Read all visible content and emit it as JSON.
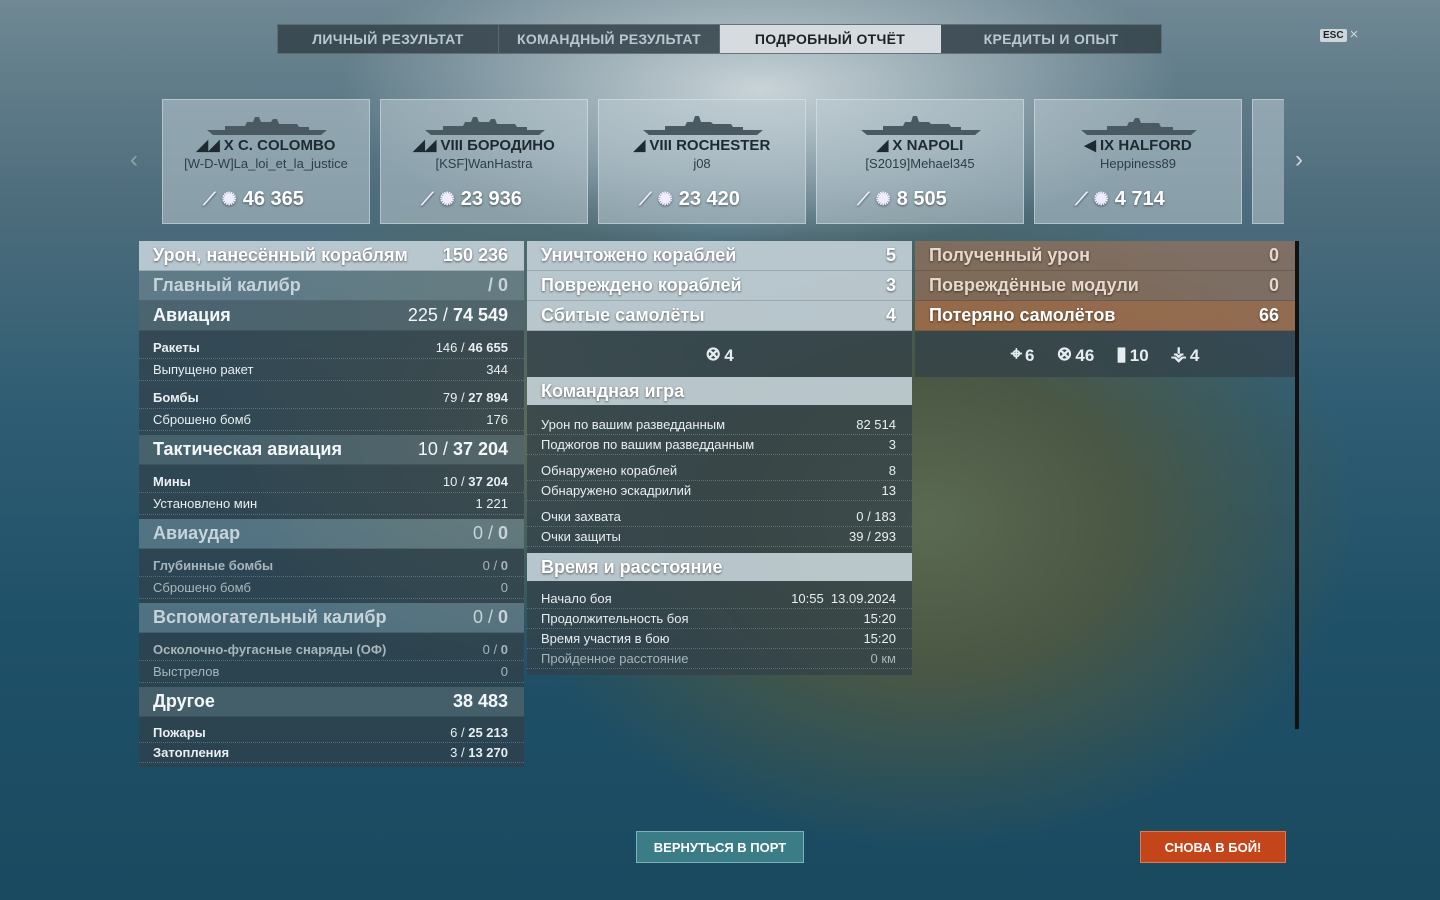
{
  "tabs": [
    {
      "label": "ЛИЧНЫЙ РЕЗУЛЬТАТ",
      "active": false
    },
    {
      "label": "КОМАНДНЫЙ РЕЗУЛЬТАТ",
      "active": false
    },
    {
      "label": "ПОДРОБНЫЙ ОТЧЁТ",
      "active": true
    },
    {
      "label": "КРЕДИТЫ И ОПЫТ",
      "active": false
    }
  ],
  "esc": {
    "key": "ESC",
    "close": "×"
  },
  "nav": {
    "prev": "‹",
    "next": "›"
  },
  "cards": [
    {
      "title": "X C. COLOMBO",
      "player": "[W-D-W]La_loi_et_la_justice",
      "damage": "46 365",
      "class_icon": "battleship-icon"
    },
    {
      "title": "VIII БОРОДИНО",
      "player": "[KSF]WanHastra",
      "damage": "23 936",
      "class_icon": "battleship-icon"
    },
    {
      "title": "VIII ROCHESTER",
      "player": "j08",
      "damage": "23 420",
      "class_icon": "cruiser-icon"
    },
    {
      "title": "X NAPOLI",
      "player": "[S2019]Mehael345",
      "damage": "8 505",
      "class_icon": "cruiser-icon"
    },
    {
      "title": "IX HALFORD",
      "player": "Heppiness89",
      "damage": "4 714",
      "class_icon": "destroyer-icon"
    }
  ],
  "left": {
    "damage": {
      "label": "Урон, нанесённый кораблям",
      "value": "150 236"
    },
    "main": {
      "label": "Главный калибр",
      "a": "/",
      "b": "0"
    },
    "aviation": {
      "label": "Авиация",
      "a": "225 /",
      "b": "74 549"
    },
    "rockets": {
      "label": "Ракеты",
      "a": "146 /",
      "b": "46 655"
    },
    "rockets_fired": {
      "label": "Выпущено ракет",
      "value": "344"
    },
    "bombs": {
      "label": "Бомбы",
      "a": "79 /",
      "b": "27 894"
    },
    "bombs_dropped": {
      "label": "Сброшено бомб",
      "value": "176"
    },
    "tactical": {
      "label": "Тактическая авиация",
      "a": "10 /",
      "b": "37 204"
    },
    "mines": {
      "label": "Мины",
      "a": "10 /",
      "b": "37 204"
    },
    "mines_set": {
      "label": "Установлено мин",
      "value": "1 221"
    },
    "airstrike": {
      "label": "Авиаудар",
      "a": "0 /",
      "b": "0"
    },
    "depth": {
      "label": "Глубинные бомбы",
      "a": "0 /",
      "b": "0"
    },
    "depth_dropped": {
      "label": "Сброшено бомб",
      "value": "0"
    },
    "secondary": {
      "label": "Вспомогательный калибр",
      "a": "0 /",
      "b": "0"
    },
    "he": {
      "label": "Осколочно-фугасные снаряды (ОФ)",
      "a": "0 /",
      "b": "0"
    },
    "shots": {
      "label": "Выстрелов",
      "value": "0"
    },
    "other": {
      "label": "Другое",
      "value": "38 483"
    },
    "fires": {
      "label": "Пожары",
      "a": "6 /",
      "b": "25 213"
    },
    "floods": {
      "label": "Затопления",
      "a": "3 /",
      "b": "13 270"
    }
  },
  "middle": {
    "destroyed": {
      "label": "Уничтожено кораблей",
      "value": "5"
    },
    "damaged": {
      "label": "Повреждено кораблей",
      "value": "3"
    },
    "planes": {
      "label": "Сбитые самолёты",
      "value": "4"
    },
    "planes_icon_value": "4",
    "team": {
      "title": "Командная игра",
      "spotting_damage": {
        "label": "Урон по вашим разведданным",
        "value": "82 514"
      },
      "spotting_fires": {
        "label": "Поджогов по вашим разведданным",
        "value": "3"
      },
      "ships_spotted": {
        "label": "Обнаружено кораблей",
        "value": "8"
      },
      "squadrons_spotted": {
        "label": "Обнаружено эскадрилий",
        "value": "13"
      },
      "capture": {
        "label": "Очки захвата",
        "value": "0 / 183"
      },
      "defense": {
        "label": "Очки защиты",
        "value": "39 / 293"
      }
    },
    "time": {
      "title": "Время и расстояние",
      "start": {
        "label": "Начало боя",
        "value": "10:55  13.09.2024"
      },
      "duration": {
        "label": "Продолжительность боя",
        "value": "15:20"
      },
      "participation": {
        "label": "Время участия в бою",
        "value": "15:20"
      },
      "distance": {
        "label": "Пройденное расстояние",
        "value": "0 км"
      }
    }
  },
  "right": {
    "received": {
      "label": "Полученный урон",
      "value": "0"
    },
    "modules": {
      "label": "Повреждённые модули",
      "value": "0"
    },
    "lost": {
      "label": "Потеряно самолётов",
      "value": "66"
    },
    "icons": [
      {
        "name": "crosshair-icon",
        "value": "6"
      },
      {
        "name": "plane-shotdown-icon",
        "value": "46"
      },
      {
        "name": "bomb-icon",
        "value": "10"
      },
      {
        "name": "aa-icon",
        "value": "4"
      }
    ]
  },
  "buttons": {
    "port": "ВЕРНУТЬСЯ В ПОРТ",
    "battle": "СНОВА В БОЙ!"
  },
  "colors": {
    "port_button": "#3b7d87",
    "battle_button": "#c4451a",
    "active_tab": "#d5dbdf"
  }
}
